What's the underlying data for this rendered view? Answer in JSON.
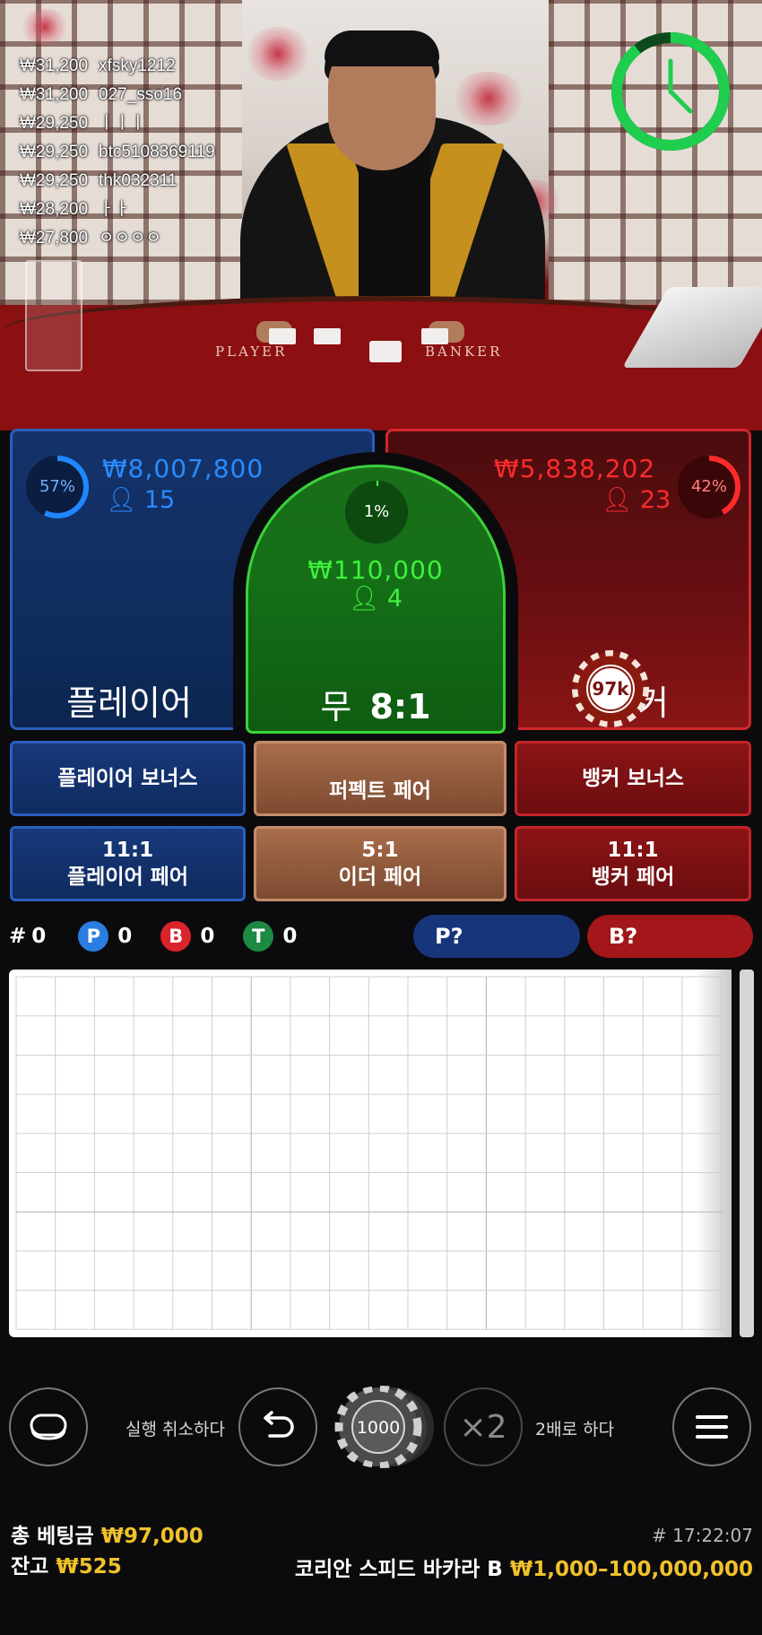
{
  "live_bets": [
    {
      "amount": "₩31,200",
      "user": "xfsky1212"
    },
    {
      "amount": "₩31,200",
      "user": "027_sso16"
    },
    {
      "amount": "₩29,250",
      "user": "ㅣㅣㅣ"
    },
    {
      "amount": "₩29,250",
      "user": "btc5108369119"
    },
    {
      "amount": "₩29,250",
      "user": "thk032311"
    },
    {
      "amount": "₩28,200",
      "user": "ㅏㅏ"
    },
    {
      "amount": "₩27,800",
      "user": "ㅇㅇㅇㅇ"
    }
  ],
  "table": {
    "player_label": "PLAYER",
    "banker_label": "BANKER"
  },
  "timer": {
    "icon": "clock-icon",
    "color": "#1fce4f"
  },
  "bet_areas": {
    "player": {
      "percent": "57%",
      "percent_value": 57,
      "amount": "₩8,007,800",
      "players": "15",
      "label": "플레이어",
      "color": "#2a8cff"
    },
    "tie": {
      "percent": "1%",
      "percent_value": 1,
      "amount": "₩110,000",
      "players": "4",
      "label": "무",
      "payout": "8:1",
      "color": "#3ef23e"
    },
    "banker": {
      "percent": "42%",
      "percent_value": 42,
      "amount": "₩5,838,202",
      "players": "23",
      "label": "뱅커",
      "color": "#ff2b2b",
      "chip": "97k"
    }
  },
  "side_bets": {
    "player_bonus": "플레이어 보너스",
    "perfect_pair": "퍼펙트 페어",
    "banker_bonus": "뱅커 보너스",
    "player_pair_odds": "11:1",
    "player_pair": "플레이어 페어",
    "either_pair_odds": "5:1",
    "either_pair": "이더 페어",
    "banker_pair_odds": "11:1",
    "banker_pair": "뱅커 페어"
  },
  "stats": {
    "rounds_prefix": "#",
    "rounds": "0",
    "player_letter": "P",
    "player_count": "0",
    "banker_letter": "B",
    "banker_count": "0",
    "tie_letter": "T",
    "tie_count": "0",
    "predict_player": "P?",
    "predict_banker": "B?"
  },
  "controls": {
    "undo_label": "실행 취소하다",
    "chip_value": "1000",
    "double_symbol": "×2",
    "double_label": "2배로 하다"
  },
  "footer": {
    "total_bet_label": "총 베팅금",
    "total_bet": "₩97,000",
    "balance_label": "잔고",
    "balance": "₩525",
    "round_time": "# 17:22:07",
    "table_name": "코리안 스피드 바카라 B",
    "limits": "₩1,000–100,000,000"
  }
}
